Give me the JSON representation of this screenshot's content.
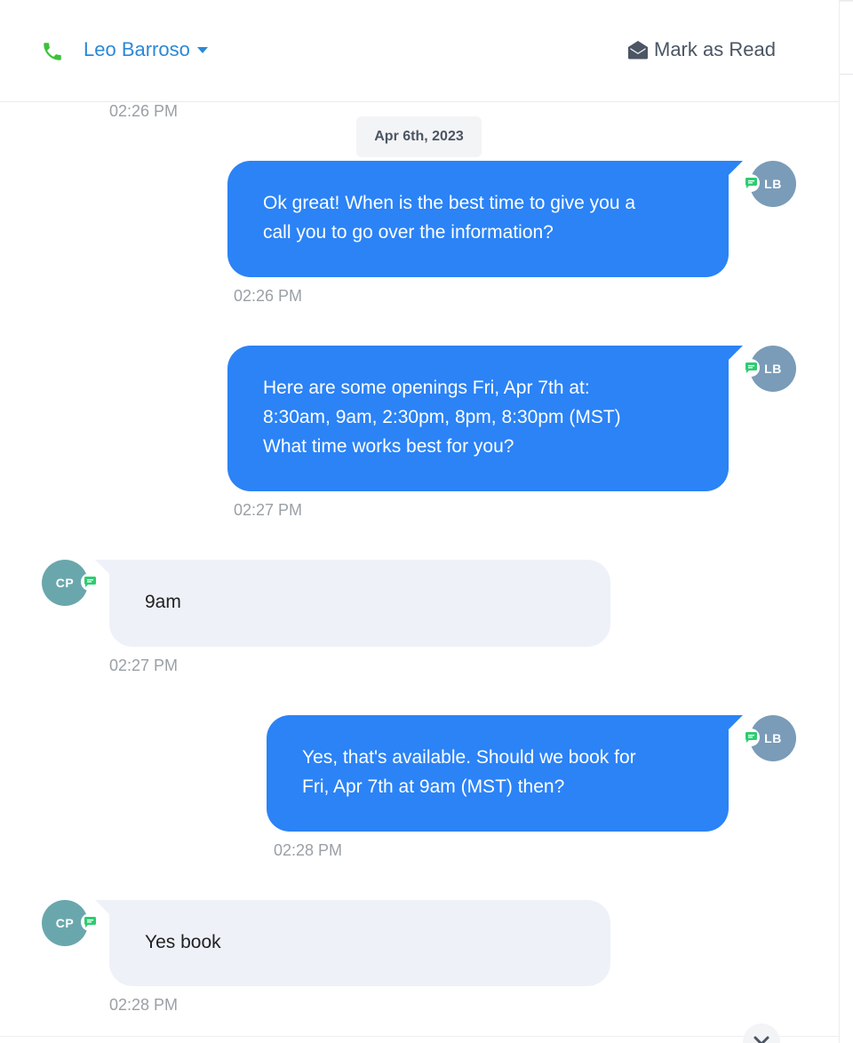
{
  "header": {
    "contact_name": "Leo Barroso",
    "mark_read_label": "Mark as Read",
    "phone_icon": "phone-icon",
    "mark_read_icon": "envelope-open-icon"
  },
  "thread": {
    "first_time": "02:26 PM",
    "date_separator": "Apr 6th, 2023",
    "messages": [
      {
        "direction": "outgoing",
        "avatar": "LB",
        "lines": [
          "Ok great! When is the best time to give you a",
          "call you to go over the information?"
        ],
        "time": "02:26 PM"
      },
      {
        "direction": "outgoing",
        "avatar": "LB",
        "lines": [
          "Here are some openings Fri, Apr 7th at:",
          "8:30am, 9am, 2:30pm, 8pm, 8:30pm (MST)",
          "What time works best for you?"
        ],
        "time": "02:27 PM"
      },
      {
        "direction": "incoming",
        "avatar": "CP",
        "lines": [
          "9am"
        ],
        "time": "02:27 PM"
      },
      {
        "direction": "outgoing",
        "avatar": "LB",
        "lines": [
          "Yes, that's available. Should we book for",
          "Fri, Apr 7th at 9am (MST) then?"
        ],
        "time": "02:28 PM"
      },
      {
        "direction": "incoming",
        "avatar": "CP",
        "lines": [
          "Yes book"
        ],
        "time": "02:28 PM"
      }
    ]
  },
  "colors": {
    "accent_blue": "#2b83f6",
    "link_blue": "#2b88d8",
    "phone_green": "#3cc13b",
    "sms_badge_green": "#2ecc71",
    "incoming_bubble": "#eef1f8"
  },
  "icons": {
    "sms_badge": "chat-bubble-icon",
    "scroll_down": "chevron-down-icon"
  }
}
